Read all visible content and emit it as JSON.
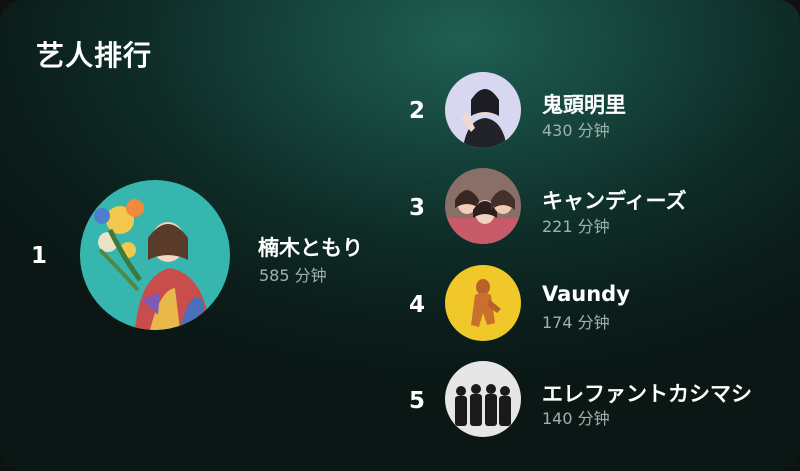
{
  "header": {
    "title": "艺人排行"
  },
  "artists": [
    {
      "rank": "1",
      "name": "楠木ともり",
      "minutes": "585 分钟",
      "avatar_icon": "artist-photo-flowers"
    },
    {
      "rank": "2",
      "name": "鬼頭明里",
      "minutes": "430 分钟",
      "avatar_icon": "artist-photo-portrait"
    },
    {
      "rank": "3",
      "name": "キャンディーズ",
      "minutes": "221 分钟",
      "avatar_icon": "artist-photo-group-trio"
    },
    {
      "rank": "4",
      "name": "Vaundy",
      "minutes": "174 分钟",
      "avatar_icon": "artist-photo-yellow"
    },
    {
      "rank": "5",
      "name": "エレファントカシマシ",
      "minutes": "140 分钟",
      "avatar_icon": "artist-photo-band-bw"
    }
  ],
  "colors": {
    "background_top": "#1f5f53",
    "background_bottom": "#0a1715",
    "secondary_text": "#9fb3ae"
  }
}
